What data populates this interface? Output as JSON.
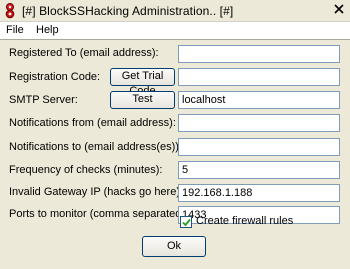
{
  "window": {
    "title": "[#] BlockSSHacking Administration.. [#]",
    "close_glyph": "[#]"
  },
  "menu": [
    "File",
    "Help"
  ],
  "form": {
    "registered_to": {
      "label": "Registered To (email address):",
      "value": ""
    },
    "registration_code": {
      "label": "Registration Code:",
      "button": "Get Trial Code",
      "value": ""
    },
    "smtp_server": {
      "label": "SMTP Server:",
      "button": "Test",
      "value": "localhost"
    },
    "notifications_from": {
      "label": "Notifications from (email address):",
      "value": ""
    },
    "notifications_to": {
      "label": "Notifications to (email address(es)):",
      "value": ""
    },
    "frequency": {
      "label": "Frequency of checks (minutes):",
      "value": "5"
    },
    "invalid_gateway_ip": {
      "label": "Invalid Gateway IP (hacks go here):",
      "value": "192.168.1.188"
    },
    "ports": {
      "label": "Ports to monitor (comma separated):",
      "value": "1433"
    },
    "create_firewall_rules": {
      "label": "Create firewall rules",
      "checked": true
    }
  },
  "ok_label": "Ok"
}
